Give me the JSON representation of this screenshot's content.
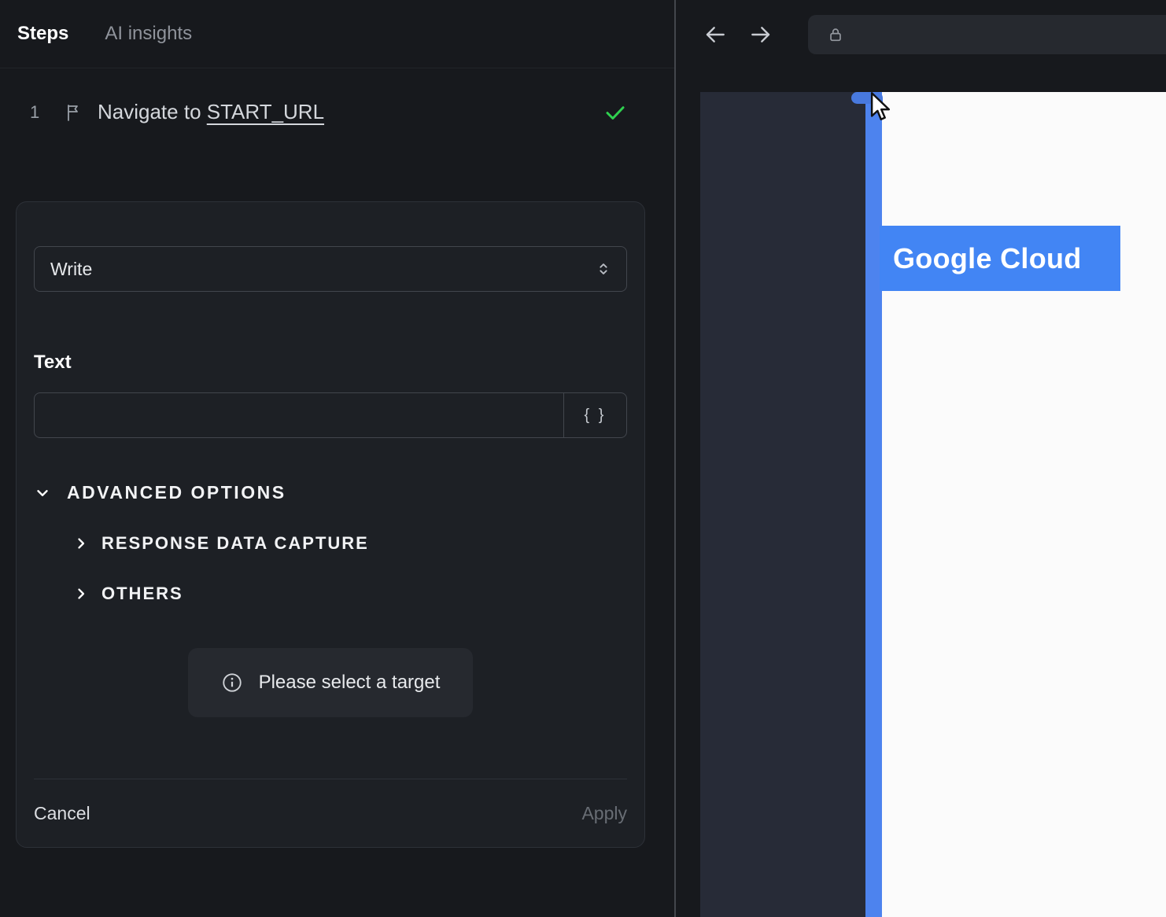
{
  "steps_panel": {
    "tabs": [
      {
        "label": "Steps",
        "active": true
      },
      {
        "label": "AI insights",
        "active": false
      }
    ],
    "step": {
      "index": "1",
      "label_prefix": "Navigate to ",
      "label_link": "START_URL",
      "status": "success"
    },
    "action_editor": {
      "action_select": {
        "value": "Write"
      },
      "text_field": {
        "label": "Text",
        "value": "",
        "placeholder": ""
      },
      "variable_button_label": "{ }",
      "advanced_options_label": "ADVANCED OPTIONS",
      "subsections": [
        {
          "label": "RESPONSE DATA CAPTURE"
        },
        {
          "label": "OTHERS"
        }
      ],
      "target_notice": "Please select a target",
      "footer": {
        "cancel_label": "Cancel",
        "apply_label": "Apply",
        "apply_enabled": false
      }
    }
  },
  "browser_panel": {
    "url_bar": {
      "value": "",
      "placeholder": ""
    },
    "page_overlay": {
      "highlight_label": "Google Cloud"
    }
  },
  "icons": {
    "step": "flag-icon",
    "step_status": "check-icon",
    "action_select": "chevron-updown-icon",
    "variable": "braces-icon",
    "advanced": "chevron-down-icon",
    "subsection": "chevron-right-icon",
    "notice": "info-icon",
    "nav_back": "arrow-left-icon",
    "nav_forward": "arrow-right-icon",
    "url": "lock-icon",
    "pointer": "cursor-icon"
  },
  "colors": {
    "accent_blue": "#4285f4",
    "highlight_blue": "#4d83ee",
    "success_green": "#2fd14f",
    "panel_bg": "#17191d",
    "card_bg": "#1d2025",
    "page_sidebar_bg": "#272b37",
    "page_bg": "#fbfbfb"
  }
}
